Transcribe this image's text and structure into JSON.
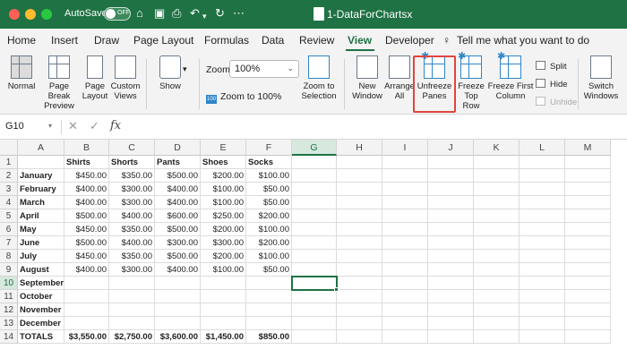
{
  "window": {
    "autosave_label": "AutoSave",
    "autosave_state": "OFF",
    "document_title": "1-DataForChartsx",
    "colors": {
      "title_bar": "#1f7244",
      "accent": "#1f7244",
      "highlight_box": "#e0463d"
    }
  },
  "tabs": [
    "Home",
    "Insert",
    "Draw",
    "Page Layout",
    "Formulas",
    "Data",
    "Review",
    "View",
    "Developer",
    "Tell me what you want to do"
  ],
  "active_tab": "View",
  "ribbon": {
    "normal": "Normal",
    "page_break_preview": "Page Break\nPreview",
    "page_layout": "Page\nLayout",
    "custom_views": "Custom\nViews",
    "show": "Show",
    "zoom_label": "Zoom",
    "zoom_value": "100%",
    "zoom_to_100": "Zoom to 100%",
    "zoom_to_selection": "Zoom to\nSelection",
    "new_window": "New\nWindow",
    "arrange_all": "Arrange\nAll",
    "unfreeze_panes": "Unfreeze\nPanes",
    "freeze_top_row": "Freeze\nTop Row",
    "freeze_first_column": "Freeze First\nColumn",
    "split": "Split",
    "hide": "Hide",
    "unhide": "Unhide",
    "switch_windows": "Switch\nWindows"
  },
  "formula_bar": {
    "name_box": "G10",
    "x_symbol": "✕",
    "check_symbol": "✓",
    "fx_symbol": "fx",
    "formula": ""
  },
  "sheet": {
    "columns": [
      "A",
      "B",
      "C",
      "D",
      "E",
      "F",
      "G",
      "H",
      "I",
      "J",
      "K",
      "L",
      "M"
    ],
    "selected_column": "G",
    "selected_row": "10",
    "rows": [
      {
        "n": "1",
        "cells": [
          "",
          "Shirts",
          "Shorts",
          "Pants",
          "Shoes",
          "Socks"
        ]
      },
      {
        "n": "2",
        "cells": [
          "January",
          "$450.00",
          "$350.00",
          "$500.00",
          "$200.00",
          "$100.00"
        ]
      },
      {
        "n": "3",
        "cells": [
          "February",
          "$400.00",
          "$300.00",
          "$400.00",
          "$100.00",
          "$50.00"
        ]
      },
      {
        "n": "4",
        "cells": [
          "March",
          "$400.00",
          "$300.00",
          "$400.00",
          "$100.00",
          "$50.00"
        ]
      },
      {
        "n": "5",
        "cells": [
          "April",
          "$500.00",
          "$400.00",
          "$600.00",
          "$250.00",
          "$200.00"
        ]
      },
      {
        "n": "6",
        "cells": [
          "May",
          "$450.00",
          "$350.00",
          "$500.00",
          "$200.00",
          "$100.00"
        ]
      },
      {
        "n": "7",
        "cells": [
          "June",
          "$500.00",
          "$400.00",
          "$300.00",
          "$300.00",
          "$200.00"
        ]
      },
      {
        "n": "8",
        "cells": [
          "July",
          "$450.00",
          "$350.00",
          "$500.00",
          "$200.00",
          "$100.00"
        ]
      },
      {
        "n": "9",
        "cells": [
          "August",
          "$400.00",
          "$300.00",
          "$400.00",
          "$100.00",
          "$50.00"
        ]
      },
      {
        "n": "10",
        "cells": [
          "September",
          "",
          "",
          "",
          "",
          ""
        ]
      },
      {
        "n": "11",
        "cells": [
          "October",
          "",
          "",
          "",
          "",
          ""
        ]
      },
      {
        "n": "12",
        "cells": [
          "November",
          "",
          "",
          "",
          "",
          ""
        ]
      },
      {
        "n": "13",
        "cells": [
          "December",
          "",
          "",
          "",
          "",
          ""
        ]
      },
      {
        "n": "14",
        "cells": [
          "TOTALS",
          "$3,550.00",
          "$2,750.00",
          "$3,600.00",
          "$1,450.00",
          "$850.00"
        ]
      }
    ]
  }
}
